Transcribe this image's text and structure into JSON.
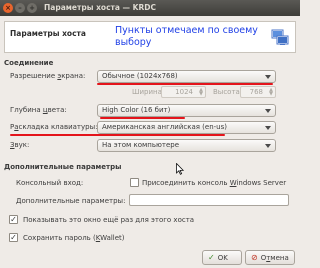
{
  "window": {
    "title": "Параметры хоста — KRDC",
    "close_glyph": "×",
    "minimize_glyph": "–",
    "maximize_glyph": "+"
  },
  "banner": {
    "title": "Параметры хоста",
    "note_line1": "Пункты отмечаем по своему",
    "note_line2": "выбору"
  },
  "connection": {
    "section": "Соединение",
    "resolution_label_pre": "Разрешение ",
    "resolution_label_ul": "э",
    "resolution_label_post": "крана:",
    "resolution_value": "Обычное (1024x768)",
    "width_label": "Ширина:",
    "width_value": "1024",
    "height_label": "Высота:",
    "height_value": "768",
    "color_label_pre": "Глубина ",
    "color_label_ul": "ц",
    "color_label_post": "вета:",
    "color_value": "High Color (16 бит)",
    "keyboard_label_pre": "Р",
    "keyboard_label_ul": "а",
    "keyboard_label_post": "складка клавиатуры:",
    "keyboard_value": "Американская английская (en-us)",
    "sound_label_pre": "",
    "sound_label_ul": "З",
    "sound_label_post": "вук:",
    "sound_value": "На этом компьютере"
  },
  "advanced": {
    "section": "Дополнительные параметры",
    "console_label": "Консольный вход:",
    "console_check_pre": "Присоединить консоль ",
    "console_check_ul": "W",
    "console_check_post": "indows Server",
    "extra_label": "Дополнительные параметры:",
    "extra_value": ""
  },
  "options": {
    "show_again": "Показывать это окно ещё раз для этого хоста",
    "save_pass_pre": "Сохранить пароль (",
    "save_pass_ul": "K",
    "save_pass_post": "Wallet)",
    "checked_glyph": "✓"
  },
  "buttons": {
    "ok": "OK",
    "ok_glyph": "✓",
    "cancel_pre": "О",
    "cancel_ul": "т",
    "cancel_post": "мена",
    "cancel_glyph": "⊘"
  },
  "colors": {
    "annotation_blue": "#2040e6",
    "annotation_red": "#e4141b",
    "close_orange": "#e9652d"
  }
}
